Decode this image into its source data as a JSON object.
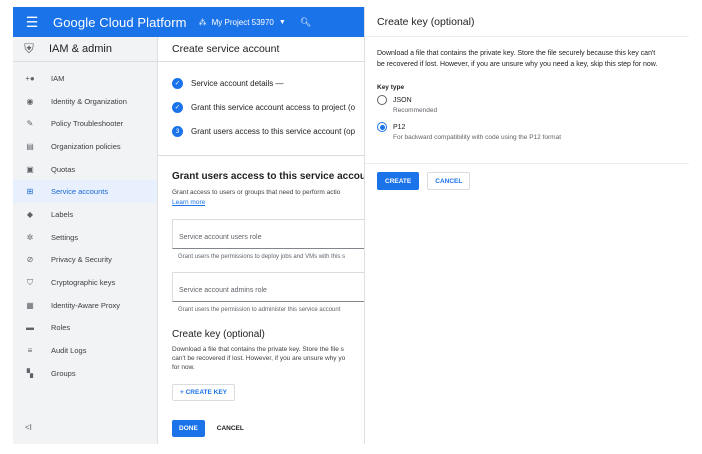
{
  "topbar": {
    "brand": "Google Cloud Platform",
    "project": "My Project 53970",
    "accent": "#1a73e8"
  },
  "sidebar": {
    "title": "IAM & admin",
    "items": [
      {
        "label": "IAM",
        "icon": "add-person-icon"
      },
      {
        "label": "Identity & Organization",
        "icon": "account-circle-icon"
      },
      {
        "label": "Policy Troubleshooter",
        "icon": "wrench-icon"
      },
      {
        "label": "Organization policies",
        "icon": "document-icon"
      },
      {
        "label": "Quotas",
        "icon": "quota-icon"
      },
      {
        "label": "Service accounts",
        "icon": "service-account-icon",
        "active": true
      },
      {
        "label": "Labels",
        "icon": "tag-icon"
      },
      {
        "label": "Settings",
        "icon": "gear-icon"
      },
      {
        "label": "Privacy & Security",
        "icon": "privacy-icon"
      },
      {
        "label": "Cryptographic keys",
        "icon": "key-shield-icon"
      },
      {
        "label": "Identity-Aware Proxy",
        "icon": "proxy-icon"
      },
      {
        "label": "Roles",
        "icon": "roles-icon"
      },
      {
        "label": "Audit Logs",
        "icon": "list-icon"
      },
      {
        "label": "Groups",
        "icon": "groups-icon"
      }
    ],
    "collapse_label": "<I"
  },
  "main": {
    "page_title": "Create service account",
    "steps": [
      {
        "badge": "✓",
        "label": "Service account details —"
      },
      {
        "badge": "✓",
        "label": "Grant this service account access to project (o"
      },
      {
        "badge": "3",
        "label": "Grant users access to this service account (op"
      }
    ],
    "grant_heading": "Grant users access to this service account",
    "grant_desc": "Grant access to users or groups that need to perform actio",
    "learn_more": "Learn more",
    "users_role_label": "Service account users role",
    "users_role_hint": "Grant users the permissions to deploy jobs and VMs with this s",
    "admins_role_label": "Service account admins role",
    "admins_role_hint": "Grant users the permission to administer this service account",
    "create_key_heading": "Create key (optional)",
    "create_key_desc_1": "Download a file that contains the private key. Store the file s",
    "create_key_desc_2": "can't be recovered if lost. However, if you are unsure why yo",
    "create_key_desc_3": "for now.",
    "create_key_button": "+ CREATE KEY",
    "done": "DONE",
    "cancel": "CANCEL"
  },
  "panel": {
    "title": "Create key (optional)",
    "description": "Download a file that contains the private key. Store the file securely because this key can't be recovered if lost. However, if you are unsure why you need a key, skip this step for now.",
    "key_type_label": "Key type",
    "options": [
      {
        "label": "JSON",
        "hint": "Recommended",
        "checked": false
      },
      {
        "label": "P12",
        "hint": "For backward compatibility with code using the P12 format",
        "checked": true
      }
    ],
    "create": "CREATE",
    "cancel": "CANCEL"
  }
}
